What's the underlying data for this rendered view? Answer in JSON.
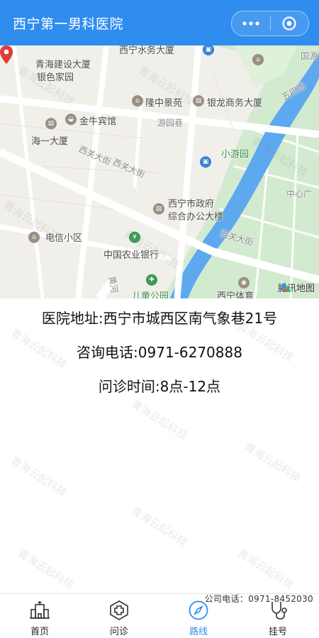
{
  "header": {
    "title": "西宁第一男科医院",
    "more_icon": "more-dots-icon",
    "close_icon": "target-close-icon"
  },
  "map": {
    "labels": {
      "xishui": "西宁水务大厦",
      "qinghai_construction": "青海建设大厦",
      "yinse": "银色家园",
      "longzhong": "隆中景苑",
      "yinlong": "银龙商务大厦",
      "jinniu": "金牛宾馆",
      "youyuan_lane": "游园巷",
      "haiyi": "海一大厦",
      "xiaoyouyuan": "小游园",
      "xiguan_st": "西关大街",
      "xiguan_st2": "西关大街",
      "xiguan_st3": "西关大街",
      "gov_line1": "西宁市政府",
      "gov_line2": "综合办公大楼",
      "dianxin": "电信小区",
      "abc_bank": "中国农业银行",
      "childrens_park": "儿童公园",
      "xining_sports": "西宁体育",
      "center_square": "中心广",
      "wuyi_road": "五四西",
      "guoyuan": "国源",
      "huanghe": "黄河"
    },
    "provider": "腾讯地图",
    "pin_icon": "location-pin-icon"
  },
  "info": {
    "address": "医院地址:西宁市城西区南气象巷21号",
    "phone": "咨询电话:0971-6270888",
    "hours": "问诊时间:8点-12点"
  },
  "watermark_text": "青海云起科技",
  "company_phone": "公司电话：0971-8452030",
  "tabs": [
    {
      "label": "首页",
      "icon": "hospital-building-icon"
    },
    {
      "label": "问诊",
      "icon": "medical-cross-icon"
    },
    {
      "label": "路线",
      "icon": "compass-icon",
      "active": true
    },
    {
      "label": "挂号",
      "icon": "stethoscope-icon"
    }
  ],
  "colors": {
    "accent": "#2f8df0",
    "map_water": "#5ea8f0",
    "map_green": "#cfe8cf"
  }
}
